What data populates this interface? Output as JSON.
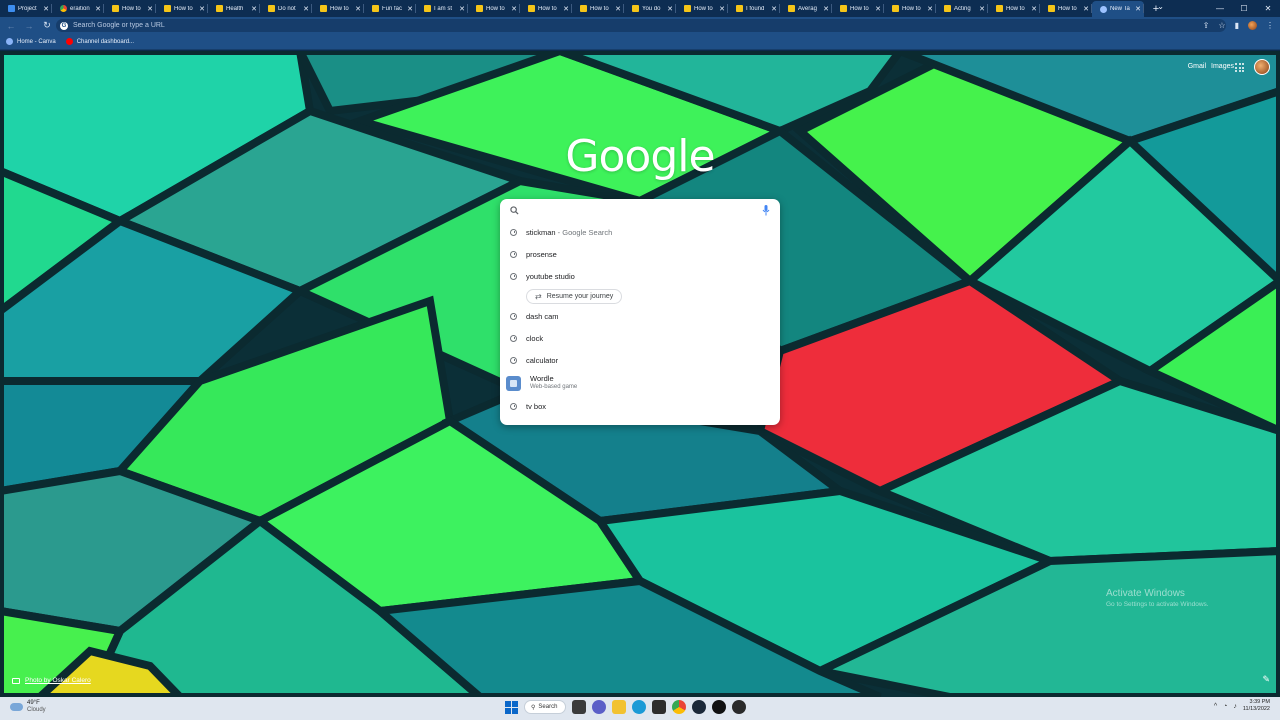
{
  "browser": {
    "tabs": [
      {
        "label": "Project",
        "icon": "blue"
      },
      {
        "label": "eraition",
        "icon": "chrome"
      },
      {
        "label": "How to",
        "icon": "yellow"
      },
      {
        "label": "How to",
        "icon": "yellow"
      },
      {
        "label": "Health",
        "icon": "yellow"
      },
      {
        "label": "Do not",
        "icon": "yellow"
      },
      {
        "label": "How to",
        "icon": "yellow"
      },
      {
        "label": "Fun fac",
        "icon": "yellow"
      },
      {
        "label": "I am st",
        "icon": "yellow"
      },
      {
        "label": "How to",
        "icon": "yellow"
      },
      {
        "label": "How to",
        "icon": "yellow"
      },
      {
        "label": "How to",
        "icon": "yellow"
      },
      {
        "label": "You do",
        "icon": "yellow"
      },
      {
        "label": "How to",
        "icon": "yellow"
      },
      {
        "label": "I found",
        "icon": "yellow"
      },
      {
        "label": "Averag",
        "icon": "yellow"
      },
      {
        "label": "How to",
        "icon": "yellow"
      },
      {
        "label": "How to",
        "icon": "yellow"
      },
      {
        "label": "Acting",
        "icon": "yellow"
      },
      {
        "label": "How to",
        "icon": "yellow"
      },
      {
        "label": "How to",
        "icon": "yellow"
      },
      {
        "label": "New Ta",
        "icon": "globe",
        "active": true
      }
    ],
    "tab_close": "✕",
    "new_tab": "+",
    "tab_list": "⌄",
    "window_controls": {
      "minimize": "—",
      "maximize": "☐",
      "close": "✕"
    },
    "nav": {
      "back": "←",
      "forward": "→",
      "reload": "↻"
    },
    "omnibox_placeholder": "Search Google or type a URL",
    "toolbar_icons": {
      "share": "⇪",
      "star": "☆",
      "side_panel": "▮",
      "menu": "⋮"
    },
    "bookmarks": [
      {
        "label": "Home - Canva",
        "icon": "canva"
      },
      {
        "label": "Channel dashboard...",
        "icon": "yt"
      }
    ]
  },
  "ntp": {
    "top_links": {
      "gmail": "Gmail",
      "images": "Images"
    },
    "logo": "Google",
    "suggestions": [
      {
        "text": "stickman",
        "suffix": " - Google Search"
      },
      {
        "text": "prosense"
      },
      {
        "text": "youtube studio"
      }
    ],
    "chip": "Resume your journey",
    "suggestions2": [
      {
        "text": "dash cam"
      },
      {
        "text": "clock"
      },
      {
        "text": "calculator"
      }
    ],
    "wordle": {
      "title": "Wordle",
      "subtitle": "Web-based game"
    },
    "last_suggestion": "tv box",
    "photo_credit": "Photo by Oskar Calero",
    "edit_icon": "✎",
    "watermark": {
      "line1": "Activate Windows",
      "line2": "Go to Settings to activate Windows."
    }
  },
  "taskbar": {
    "weather": {
      "temp": "49°F",
      "condition": "Cloudy"
    },
    "search": "Search",
    "time": "3:39 PM",
    "date": "11/13/2022",
    "tray_up": "^"
  },
  "colors": {
    "tabstrip": "#0d2d52",
    "toolbar": "#1f4f86",
    "taskbar": "#dfe6ef"
  }
}
